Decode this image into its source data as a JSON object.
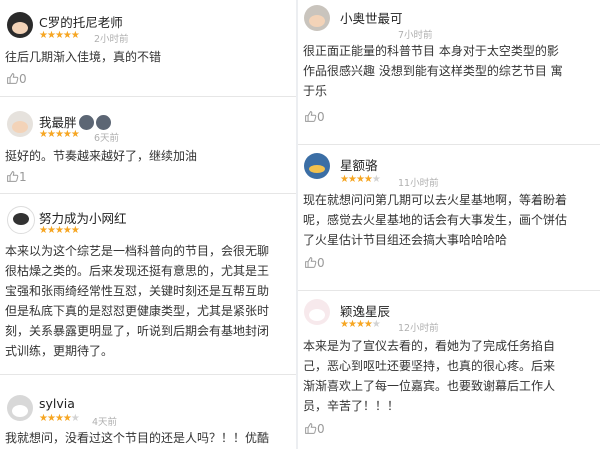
{
  "left": [
    {
      "name": "C罗的托尼老师",
      "stars": 5,
      "time": "2小时前",
      "lines": [
        "往后几期渐入佳境，真的不错"
      ],
      "likes": "0"
    },
    {
      "name": "我最胖",
      "stars": 5,
      "time": "6天前",
      "lines": [
        "挺好的。节奏越来越好了，继续加油"
      ],
      "likes": "1"
    },
    {
      "name": "努力成为小网红",
      "stars": 5,
      "time": "",
      "lines": [
        "本来以为这个综艺是一档科普向的节目，会很无聊",
        "很枯燥之类的。后来发现还挺有意思的，尤其是王",
        "宝强和张雨绮经常性互怼，关键时刻还是互帮互助",
        "但是私底下真的是怼怼更健康类型，尤其是紧张时",
        "刻，关系暴露更明显了，听说到后期会有基地封闭",
        "式训练，更期待了。"
      ],
      "likes": "0"
    },
    {
      "name": "sylvia",
      "stars": 4,
      "time": "4天前",
      "lines": [
        "我就想问，没看过这个节目的还是人吗？！！优酷"
      ],
      "likes": ""
    }
  ],
  "right": [
    {
      "name": "小奥世最可",
      "stars": 0,
      "time": "7小时前",
      "lines": [
        "很正面正能量的科普节目 本身对于太空类型的影",
        "作品很感兴趣 没想到能有这样类型的综艺节目 寓",
        "于乐"
      ],
      "likes": "0"
    },
    {
      "name": "星额骆",
      "stars": 4,
      "time": "11小时前",
      "lines": [
        "现在就想问问第几期可以去火星基地啊，等着盼着",
        "呢，感觉去火星基地的话会有大事发生，画个饼估",
        "了火星估计节目组还会搞大事哈哈哈哈"
      ],
      "likes": "0"
    },
    {
      "name": "颖逸星辰",
      "stars": 4,
      "time": "12小时前",
      "lines": [
        "本来是为了宣仪去看的，看她为了完成任务掐自",
        "己，恶心到呕吐还要坚持，也真的很心疼。后来",
        "渐渐喜欢上了每一位嘉宾。也要致谢幕后工作人",
        "员，辛苦了！！！"
      ],
      "likes": "0"
    }
  ],
  "colors": {
    "star": "#f6a623",
    "star_off": "#d3d3d3",
    "text": "#333333",
    "meta": "#b0b0b0"
  },
  "icons": {
    "like": "thumbs-up-icon",
    "badge": "user-badge-icon"
  }
}
